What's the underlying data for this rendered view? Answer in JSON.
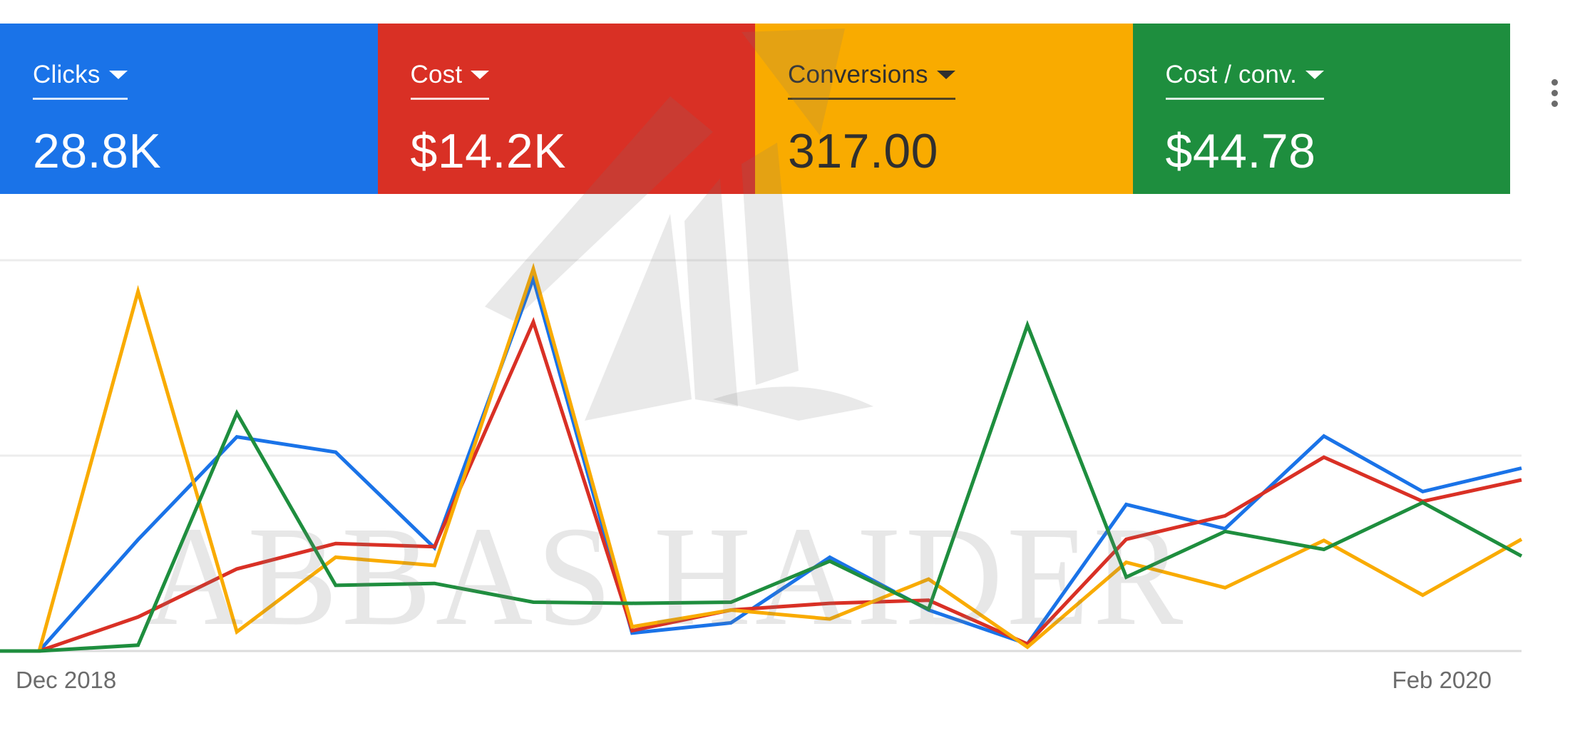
{
  "scorecards": [
    {
      "label": "Clicks",
      "value": "28.8K",
      "color": "#1a73e8"
    },
    {
      "label": "Cost",
      "value": "$14.2K",
      "color": "#d93025"
    },
    {
      "label": "Conversions",
      "value": "317.00",
      "color": "#f9ab00"
    },
    {
      "label": "Cost / conv.",
      "value": "$44.78",
      "color": "#1e8e3e"
    }
  ],
  "menu_icon": "more-vert-icon",
  "watermark": {
    "text": "ABBAS HAIDER",
    "logo": "rising-arrow-logo"
  },
  "chart_data": {
    "type": "line",
    "x_tick_labels": [
      "Dec 2018",
      "Feb 2020"
    ],
    "x": [
      0,
      1,
      2,
      3,
      4,
      5,
      6,
      7,
      8,
      9,
      10,
      11,
      12,
      13,
      14,
      15
    ],
    "ylim": [
      0,
      1
    ],
    "grid": true,
    "series": [
      {
        "name": "Clicks",
        "color": "#1a73e8",
        "values": [
          0,
          0.285,
          0.548,
          0.509,
          0.264,
          0.953,
          0.046,
          0.072,
          0.24,
          0.105,
          0.018,
          0.375,
          0.313,
          0.55,
          0.408,
          0.468
        ]
      },
      {
        "name": "Cost",
        "color": "#d93025",
        "values": [
          0,
          0.087,
          0.21,
          0.275,
          0.267,
          0.842,
          0.052,
          0.105,
          0.122,
          0.13,
          0.018,
          0.286,
          0.346,
          0.496,
          0.383,
          0.438
        ]
      },
      {
        "name": "Conversions",
        "color": "#f9ab00",
        "values": [
          0,
          0.92,
          0.049,
          0.24,
          0.219,
          0.978,
          0.062,
          0.105,
          0.082,
          0.184,
          0.01,
          0.227,
          0.162,
          0.283,
          0.143,
          0.286
        ]
      },
      {
        "name": "Cost / conv.",
        "color": "#1e8e3e",
        "values": [
          0,
          0.015,
          0.609,
          0.168,
          0.173,
          0.125,
          0.122,
          0.125,
          0.23,
          0.107,
          0.834,
          0.189,
          0.306,
          0.26,
          0.38,
          0.243
        ]
      }
    ]
  }
}
